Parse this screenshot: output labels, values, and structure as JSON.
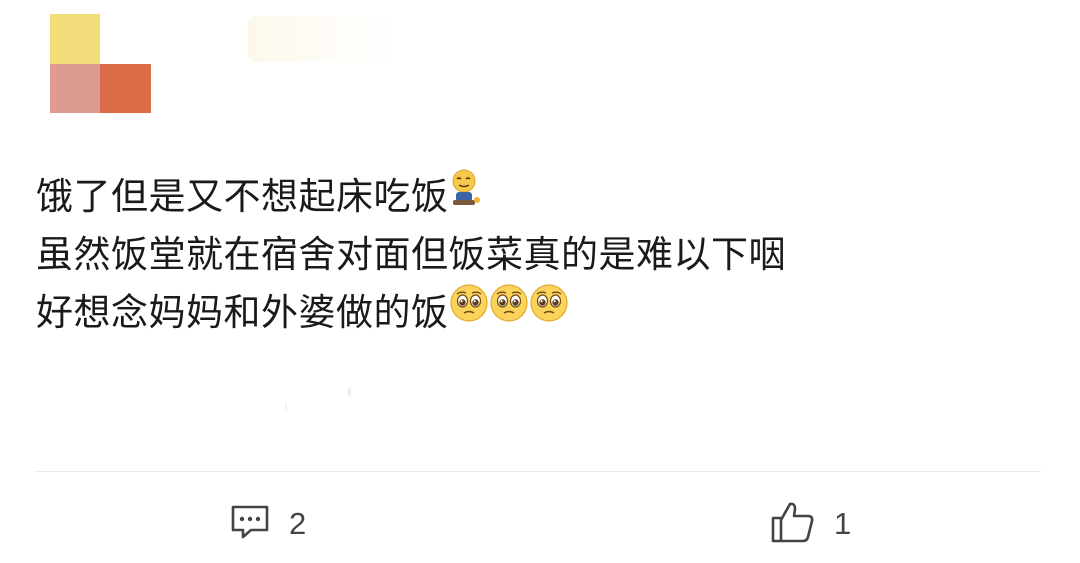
{
  "post": {
    "lines": [
      "饿了但是又不想起床吃饭",
      "虽然饭堂就在宿舍对面但饭菜真的是难以下咽",
      "好想念妈妈和外婆做的饭"
    ],
    "emojis": {
      "line1": "slacking-off-emoji",
      "line3": [
        "pleading-face-emoji",
        "pleading-face-emoji",
        "pleading-face-emoji"
      ]
    }
  },
  "avatar": {
    "colors": {
      "top_left": "#f3dc7a",
      "bottom_left": "#dd9b92",
      "bottom_right": "#db6c47"
    }
  },
  "actions": {
    "comment": {
      "icon": "comment-icon",
      "count": "2"
    },
    "like": {
      "icon": "thumbs-up-icon",
      "count": "1"
    }
  }
}
